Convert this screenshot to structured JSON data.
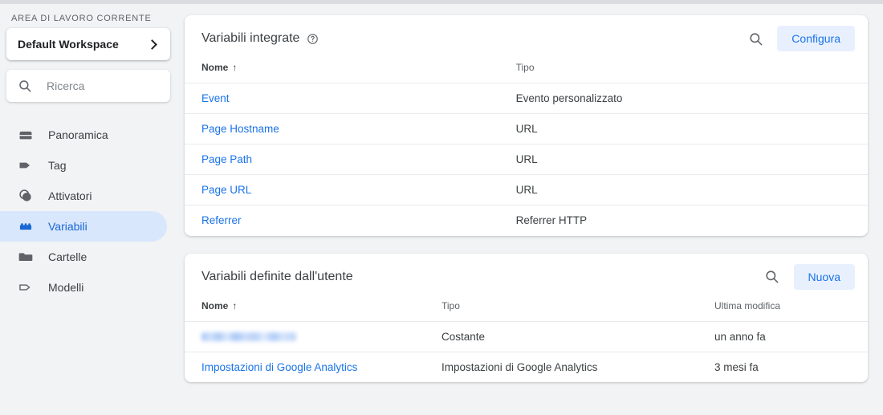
{
  "sidebar": {
    "workspace_label": "AREA DI LAVORO CORRENTE",
    "workspace_name": "Default Workspace",
    "search_placeholder": "Ricerca",
    "items": [
      {
        "label": "Panoramica",
        "icon": "overview-icon",
        "active": false
      },
      {
        "label": "Tag",
        "icon": "tag-icon",
        "active": false
      },
      {
        "label": "Attivatori",
        "icon": "trigger-icon",
        "active": false
      },
      {
        "label": "Variabili",
        "icon": "variable-icon",
        "active": true
      },
      {
        "label": "Cartelle",
        "icon": "folder-icon",
        "active": false
      },
      {
        "label": "Modelli",
        "icon": "template-icon",
        "active": false
      }
    ]
  },
  "cards": [
    {
      "title": "Variabili integrate",
      "has_help_icon": true,
      "search_icon": "search-icon",
      "action_label": "Configura",
      "columns": [
        "Nome",
        "Tipo"
      ],
      "sort_indicator": "↑",
      "rows": [
        {
          "name": "Event",
          "type": "Evento personalizzato"
        },
        {
          "name": "Page Hostname",
          "type": "URL"
        },
        {
          "name": "Page Path",
          "type": "URL"
        },
        {
          "name": "Page URL",
          "type": "URL"
        },
        {
          "name": "Referrer",
          "type": "Referrer HTTP"
        }
      ]
    },
    {
      "title": "Variabili definite dall'utente",
      "has_help_icon": false,
      "search_icon": "search-icon",
      "action_label": "Nuova",
      "columns": [
        "Nome",
        "Tipo",
        "Ultima modifica"
      ],
      "sort_indicator": "↑",
      "rows": [
        {
          "name": "",
          "redacted": true,
          "type": "Costante",
          "modified": "un anno fa"
        },
        {
          "name": "Impostazioni di Google Analytics",
          "redacted": false,
          "type": "Impostazioni di Google Analytics",
          "modified": "3 mesi fa"
        }
      ]
    }
  ],
  "colors": {
    "accent": "#1a73e8",
    "accent_bg": "#e8f0fe",
    "active_nav_bg": "#d9e7fd",
    "active_nav_text": "#1967d2",
    "page_bg": "#f1f3f4"
  }
}
